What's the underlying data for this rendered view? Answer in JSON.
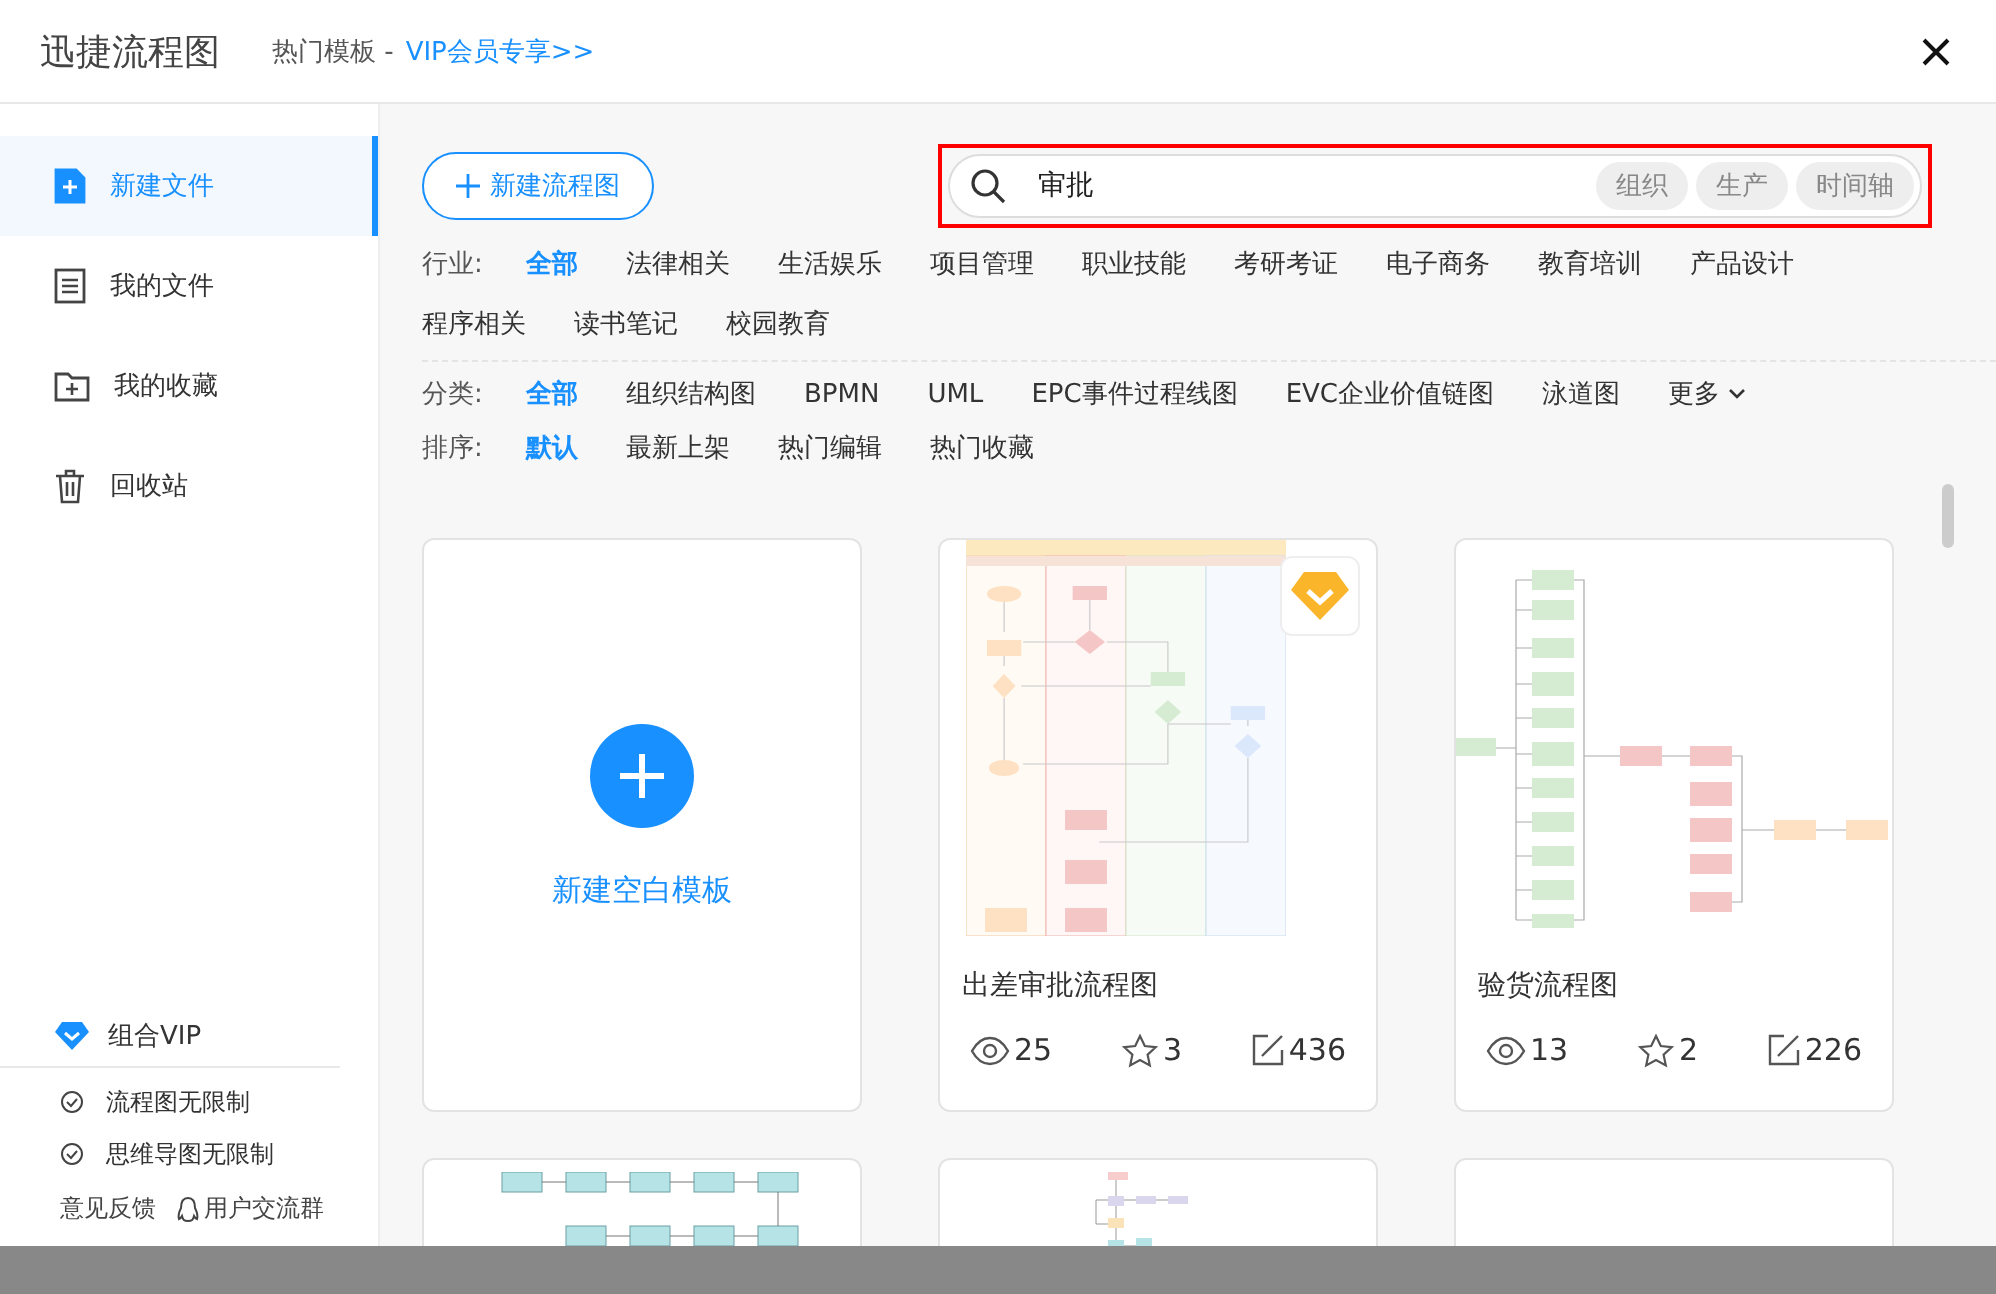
{
  "header": {
    "title": "迅捷流程图",
    "subtitle": "热门模板 -",
    "vip_link": "VIP会员专享>>"
  },
  "sidebar": {
    "items": [
      {
        "label": "新建文件",
        "selected": true
      },
      {
        "label": "我的文件",
        "selected": false
      },
      {
        "label": "我的收藏",
        "selected": false
      },
      {
        "label": "回收站",
        "selected": false
      }
    ],
    "vip": {
      "label": "组合VIP"
    },
    "perks": [
      "流程图无限制",
      "思维导图无限制"
    ],
    "footer_links": [
      {
        "label": "意见反馈"
      },
      {
        "label": "用户交流群"
      }
    ]
  },
  "new_button": {
    "label": "新建流程图"
  },
  "search": {
    "value": "审批",
    "tags": [
      "组织",
      "生产",
      "时间轴"
    ],
    "highlighted": true
  },
  "filters": [
    {
      "label": "行业:",
      "options": [
        {
          "label": "全部",
          "selected": true
        },
        {
          "label": "法律相关",
          "selected": false
        },
        {
          "label": "生活娱乐",
          "selected": false
        },
        {
          "label": "项目管理",
          "selected": false
        },
        {
          "label": "职业技能",
          "selected": false
        },
        {
          "label": "考研考证",
          "selected": false
        },
        {
          "label": "电子商务",
          "selected": false
        },
        {
          "label": "教育培训",
          "selected": false
        },
        {
          "label": "产品设计",
          "selected": false
        },
        {
          "label": "程序相关",
          "selected": false
        },
        {
          "label": "读书笔记",
          "selected": false
        },
        {
          "label": "校园教育",
          "selected": false
        }
      ]
    },
    {
      "label": "分类:",
      "options": [
        {
          "label": "全部",
          "selected": true
        },
        {
          "label": "组织结构图",
          "selected": false
        },
        {
          "label": "BPMN",
          "selected": false
        },
        {
          "label": "UML",
          "selected": false
        },
        {
          "label": "EPC事件过程线图",
          "selected": false
        },
        {
          "label": "EVC企业价值链图",
          "selected": false
        },
        {
          "label": "泳道图",
          "selected": false
        },
        {
          "label": "更多",
          "selected": false,
          "kind": "dropdown"
        }
      ]
    },
    {
      "label": "排序:",
      "options": [
        {
          "label": "默认",
          "selected": true
        },
        {
          "label": "最新上架",
          "selected": false
        },
        {
          "label": "热门编辑",
          "selected": false
        },
        {
          "label": "热门收藏",
          "selected": false
        }
      ]
    }
  ],
  "cards": [
    {
      "kind": "new",
      "label": "新建空白模板"
    },
    {
      "kind": "template",
      "vip": true,
      "title": "出差审批流程图",
      "views": "25",
      "stars": "3",
      "edits": "436"
    },
    {
      "kind": "template",
      "vip": false,
      "title": "验货流程图",
      "views": "13",
      "stars": "2",
      "edits": "226"
    },
    {
      "kind": "preview"
    },
    {
      "kind": "preview"
    },
    {
      "kind": "preview"
    }
  ]
}
